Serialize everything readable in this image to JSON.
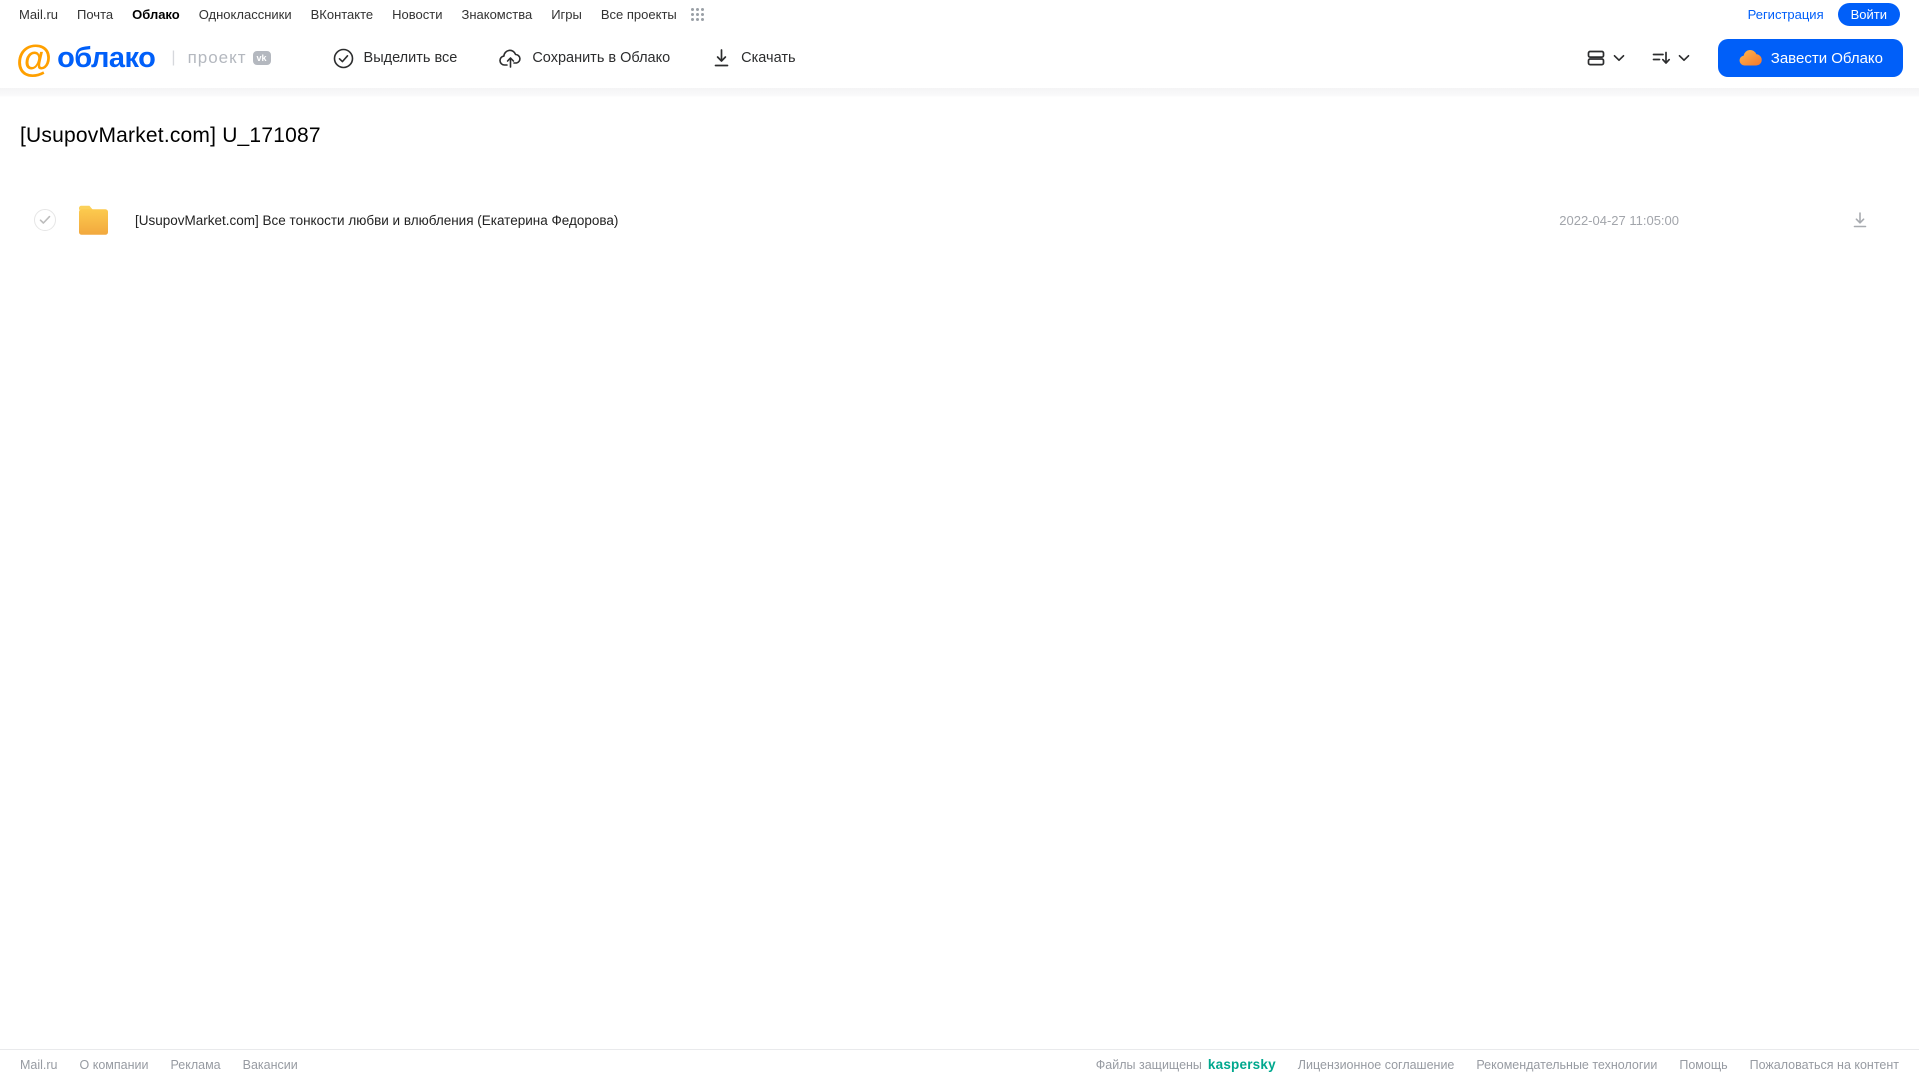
{
  "topnav": {
    "links": [
      "Mail.ru",
      "Почта",
      "Облако",
      "Одноклассники",
      "ВКонтакте",
      "Новости",
      "Знакомства",
      "Игры",
      "Все проекты"
    ],
    "active_link": "Облако",
    "registration_label": "Регистрация",
    "login_label": "Войти"
  },
  "header": {
    "logo_text": "облако",
    "logo_at": "@",
    "project_label": "проект",
    "vk_badge": "vk",
    "toolbar": {
      "select_all_label": "Выделить все",
      "save_to_cloud_label": "Сохранить в Облако",
      "download_label": "Скачать"
    },
    "cta_label": "Завести Облако"
  },
  "page": {
    "title": "[UsupovMarket.com] U_171087"
  },
  "files": [
    {
      "type": "folder",
      "name": "[UsupovMarket.com] Все тонкости любви и влюбления (Екатерина Федорова)",
      "date": "2022-04-27 11:05:00"
    }
  ],
  "footer": {
    "left_links": [
      "Mail.ru",
      "О компании",
      "Реклама",
      "Вакансии"
    ],
    "protected_label": "Файлы защищены",
    "kaspersky_label": "kaspersky",
    "right_links": [
      "Лицензионное соглашение",
      "Рекомендательные технологии",
      "Помощь",
      "Пожаловаться на контент"
    ]
  },
  "colors": {
    "accent_blue": "#005ff9",
    "logo_orange": "#ffa000",
    "kaspersky_green": "#00a88e",
    "folder_yellow_top": "#fbd15b",
    "folder_yellow_bottom": "#f2a83e",
    "muted_gray": "#979ba2"
  }
}
